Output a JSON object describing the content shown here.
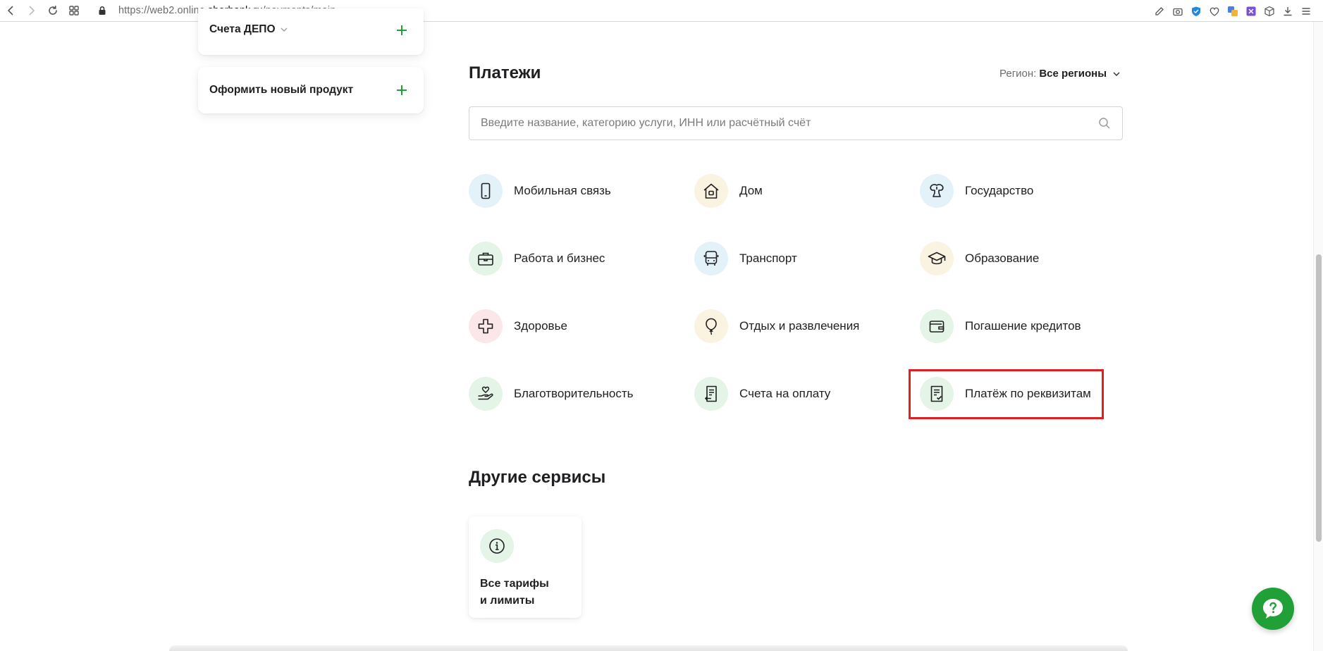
{
  "browser": {
    "url_prefix": "https://web2.online.",
    "url_host": "sberbank.ru",
    "url_path": "/payments/main"
  },
  "sidebar": {
    "depo_title": "Счета ДЕПО",
    "new_product_title": "Оформить новый продукт"
  },
  "payments": {
    "title": "Платежи",
    "region_label": "Регион:",
    "region_value": "Все регионы",
    "search_placeholder": "Введите название, категорию услуги, ИНН или расчётный счёт",
    "categories": [
      {
        "label": "Мобильная связь",
        "icon": "mobile-phone-icon"
      },
      {
        "label": "Дом",
        "icon": "house-icon"
      },
      {
        "label": "Государство",
        "icon": "government-emblem-icon"
      },
      {
        "label": "Работа и бизнес",
        "icon": "briefcase-icon"
      },
      {
        "label": "Транспорт",
        "icon": "bus-icon"
      },
      {
        "label": "Образование",
        "icon": "graduation-cap-icon"
      },
      {
        "label": "Здоровье",
        "icon": "medical-cross-icon"
      },
      {
        "label": "Отдых и развлечения",
        "icon": "balloon-icon"
      },
      {
        "label": "Погашение кредитов",
        "icon": "wallet-icon"
      },
      {
        "label": "Благотворительность",
        "icon": "heart-in-hand-icon"
      },
      {
        "label": "Счета на оплату",
        "icon": "invoice-icon"
      },
      {
        "label": "Платёж по реквизитам",
        "icon": "document-check-icon"
      }
    ]
  },
  "other_services": {
    "title": "Другие сервисы",
    "card_line1": "Все тарифы",
    "card_line2": "и лимиты",
    "card_icon": "info-icon"
  },
  "colors": {
    "brand_green": "#21a038",
    "highlight_red": "#e02020"
  }
}
